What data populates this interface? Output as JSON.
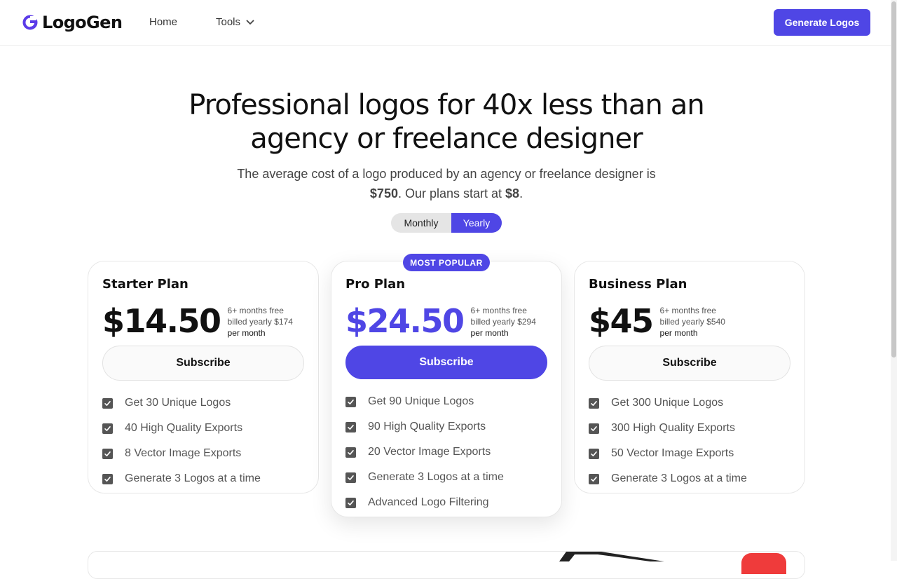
{
  "header": {
    "brand": "LogoGen",
    "nav": {
      "home": "Home",
      "tools": "Tools"
    },
    "cta": "Generate Logos"
  },
  "colors": {
    "accent": "#4f46e5",
    "text": "#111111",
    "muted": "#555555"
  },
  "hero": {
    "title_line1": "Professional logos for 40x less than an",
    "title_line2": "agency or freelance designer",
    "sub_line1": "The average cost of a logo produced by an agency or freelance designer is",
    "sub_price1": "$750",
    "sub_mid": ". Our plans start at ",
    "sub_price2": "$8",
    "sub_end": "."
  },
  "billing_toggle": {
    "monthly": "Monthly",
    "yearly": "Yearly",
    "selected": "Yearly"
  },
  "plans": [
    {
      "name": "Starter Plan",
      "price": "$14.50",
      "free_note": "6+ months free",
      "billed": "billed yearly $174",
      "period": "per month",
      "button": "Subscribe",
      "features": [
        "Get 30 Unique Logos",
        "40 High Quality Exports",
        "8 Vector Image Exports",
        "Generate 3 Logos at a time"
      ]
    },
    {
      "name": "Pro Plan",
      "badge": "MOST POPULAR",
      "price": "$24.50",
      "free_note": "6+ months free",
      "billed": "billed yearly $294",
      "period": "per month",
      "button": "Subscribe",
      "features": [
        "Get 90 Unique Logos",
        "90 High Quality Exports",
        "20 Vector Image Exports",
        "Generate 3 Logos at a time",
        "Advanced Logo Filtering"
      ]
    },
    {
      "name": "Business Plan",
      "price": "$45",
      "free_note": "6+ months free",
      "billed": "billed yearly $540",
      "period": "per month",
      "button": "Subscribe",
      "features": [
        "Get 300 Unique Logos",
        "300 High Quality Exports",
        "50 Vector Image Exports",
        "Generate 3 Logos at a time"
      ]
    }
  ],
  "icons": {
    "logo": "logogen-mark-icon",
    "dropdown": "chevron-down-icon",
    "feature": "checkbox-checked-icon"
  }
}
